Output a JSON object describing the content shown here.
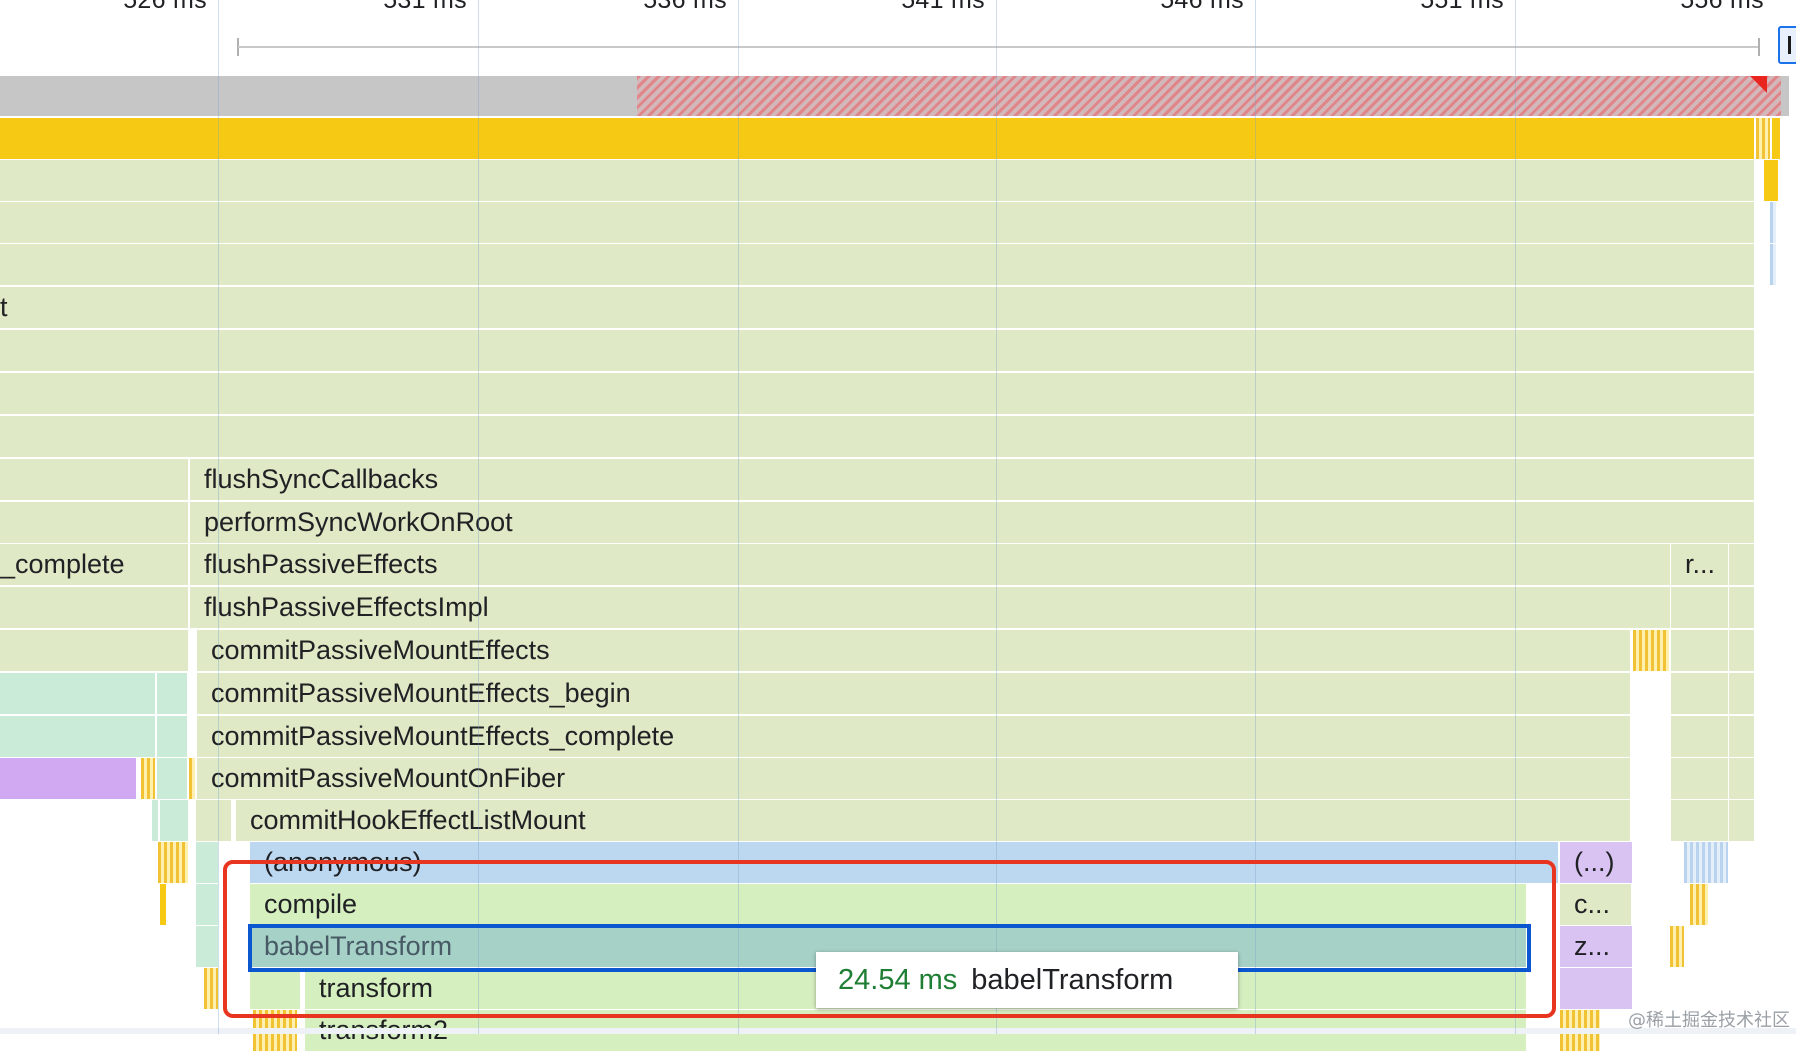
{
  "ruler": {
    "ticks": [
      "526 ms",
      "531 ms",
      "536 ms",
      "541 ms",
      "546 ms",
      "551 ms",
      "556 ms"
    ]
  },
  "flame": {
    "row_t": "t",
    "row_complete": "_complete",
    "flushSyncCallbacks": "flushSyncCallbacks",
    "performSyncWorkOnRoot": "performSyncWorkOnRoot",
    "flushPassiveEffects": "flushPassiveEffects",
    "flushPassiveEffects_trunc": "r...",
    "flushPassiveEffectsImpl": "flushPassiveEffectsImpl",
    "commitPassiveMountEffects": "commitPassiveMountEffects",
    "commitPassiveMountEffects_begin": "commitPassiveMountEffects_begin",
    "commitPassiveMountEffects_complete": "commitPassiveMountEffects_complete",
    "commitPassiveMountOnFiber": "commitPassiveMountOnFiber",
    "commitHookEffectListMount": "commitHookEffectListMount",
    "anonymous": "(anonymous)",
    "anonymous_trunc": "(...)",
    "compile": "compile",
    "compile_trunc": "c...",
    "babelTransform": "babelTransform",
    "babelTransform_trunc": "z...",
    "transform": "transform",
    "transform2": "transform2"
  },
  "tooltip": {
    "duration": "24.54 ms",
    "name": "babelTransform"
  },
  "watermark": "@稀土掘金技术社区",
  "colors": {
    "js_yellow": "#f6c915",
    "frame_green": "#dfe9c5",
    "selected": "#a6d1c6",
    "highlight_red": "#e8351f",
    "highlight_blue": "#0b57d0",
    "tooltip_duration": "#1e7f34"
  }
}
